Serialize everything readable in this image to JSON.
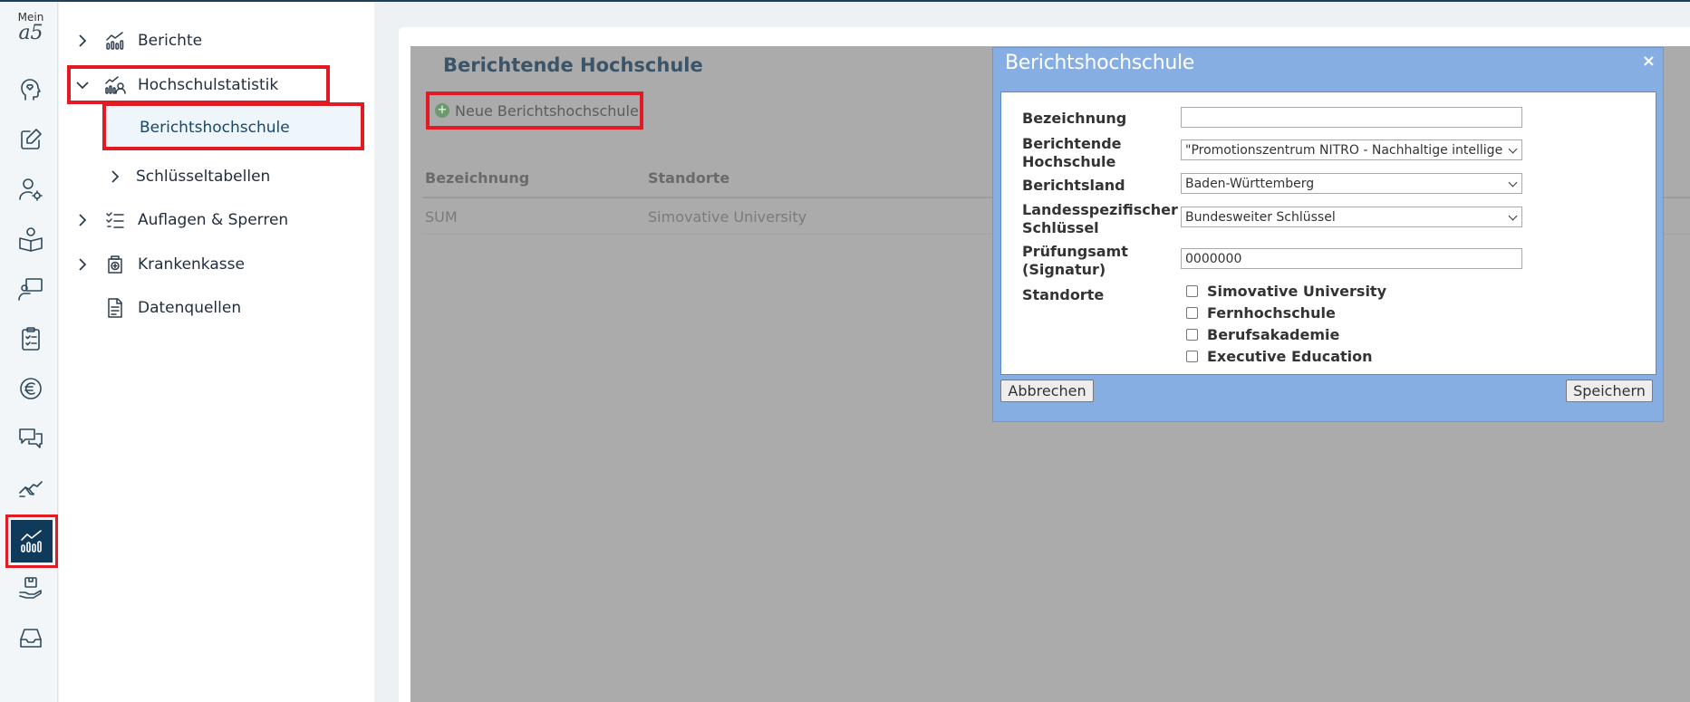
{
  "rail": {
    "logo_small": "Mein",
    "logo_big": "a5",
    "icons": [
      "head-heart-icon",
      "edit-icon",
      "user-settings-icon",
      "book-person-icon",
      "teacher-board-icon",
      "clipboard-list-icon",
      "euro-icon",
      "chat-icon",
      "handshake-icon",
      "statistics-icon",
      "hand-box-icon",
      "inbox-icon"
    ],
    "active_icon": "statistics-icon"
  },
  "tree": {
    "items": [
      {
        "label": "Berichte",
        "icon": "chart-icon",
        "expanded": false
      },
      {
        "label": "Hochschulstatistik",
        "icon": "chart-people-icon",
        "expanded": true
      },
      {
        "label": "Berichtshochschule",
        "icon": "",
        "active": true
      },
      {
        "label": "Schlüsseltabellen",
        "icon": "",
        "expanded": false
      },
      {
        "label": "Auflagen & Sperren",
        "icon": "checklist-icon",
        "expanded": false
      },
      {
        "label": "Krankenkasse",
        "icon": "medical-bag-icon",
        "expanded": false
      },
      {
        "label": "Datenquellen",
        "icon": "document-icon"
      }
    ]
  },
  "main": {
    "title": "Berichtende Hochschule",
    "new_button": "Neue Berichtshochschule",
    "columns": [
      "Bezeichnung",
      "Standorte"
    ],
    "rows": [
      {
        "bezeichnung": "SUM",
        "standorte": "Simovative University"
      }
    ]
  },
  "dialog": {
    "title": "Berichtshochschule",
    "close": "×",
    "fields": {
      "bezeichnung_label": "Bezeichnung",
      "bezeichnung_value": "",
      "hochschule_label_1": "Berichtende",
      "hochschule_label_2": "Hochschule",
      "hochschule_value": "\"Promotionszentrum NITRO - Nachhaltige intelligente",
      "land_label": "Berichtsland",
      "land_value": "Baden-Württemberg",
      "schluessel_label_1": "Landesspezifischer",
      "schluessel_label_2": "Schlüssel",
      "schluessel_value": "Bundesweiter Schlüssel",
      "pruefungsamt_label_1": "Prüfungsamt",
      "pruefungsamt_label_2": "(Signatur)",
      "pruefungsamt_value": "0000000",
      "standorte_label": "Standorte"
    },
    "standorte": [
      {
        "label": "Simovative University",
        "checked": false
      },
      {
        "label": "Fernhochschule",
        "checked": false
      },
      {
        "label": "Berufsakademie",
        "checked": false
      },
      {
        "label": "Executive Education",
        "checked": false
      }
    ],
    "cancel": "Abbrechen",
    "save": "Speichern"
  },
  "colors": {
    "highlight": "#e01b24",
    "rail_active": "#0f3a5a",
    "dialog": "#86aee3",
    "overlay": "#ababab"
  }
}
